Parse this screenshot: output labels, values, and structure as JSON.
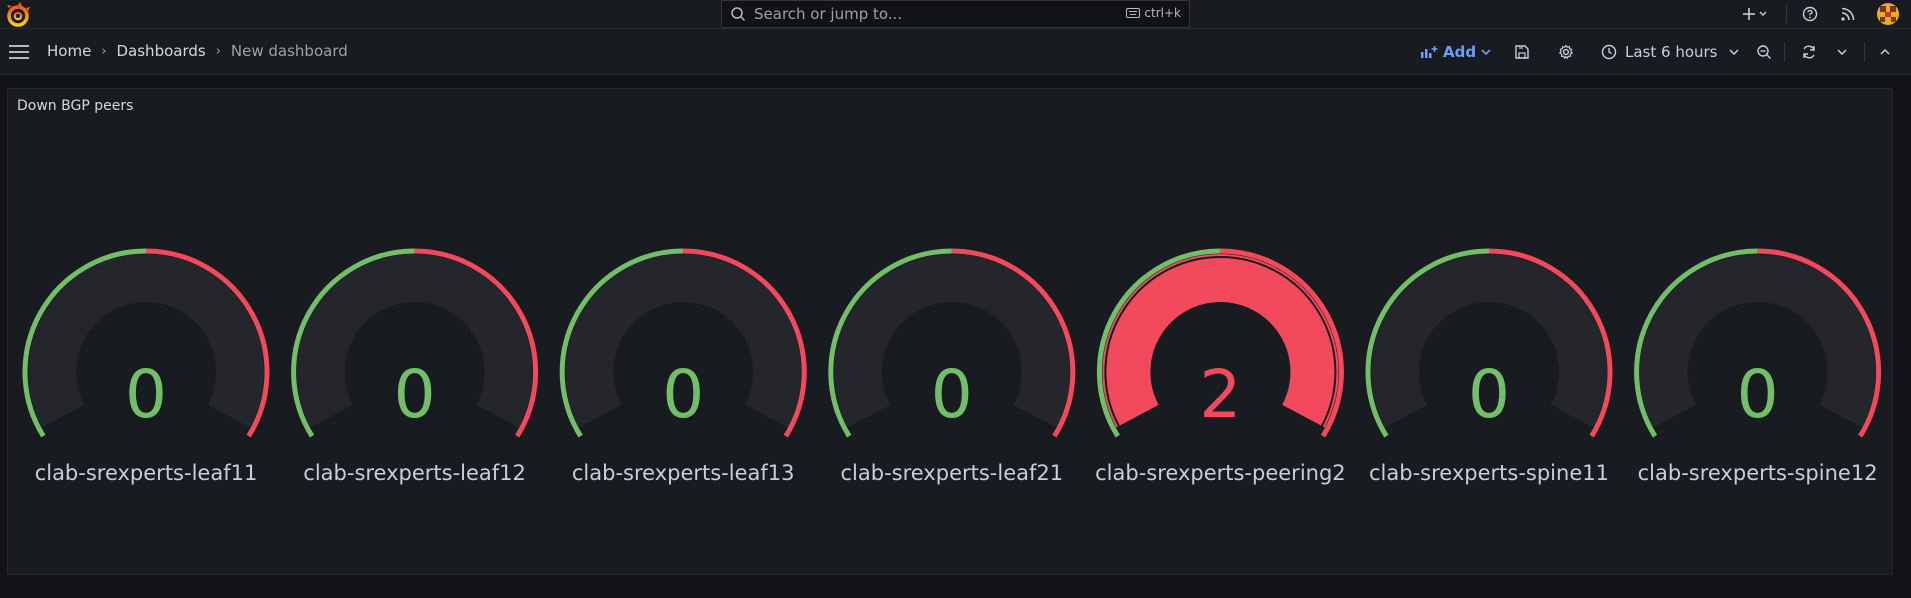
{
  "search": {
    "placeholder": "Search or jump to...",
    "shortcut": "ctrl+k"
  },
  "breadcrumb": {
    "home": "Home",
    "dashboards": "Dashboards",
    "current": "New dashboard"
  },
  "toolbar": {
    "add_label": "Add",
    "time_range": "Last 6 hours"
  },
  "panel": {
    "title": "Down BGP peers",
    "gauges": [
      {
        "label": "clab-srexperts-leaf11",
        "value": "0",
        "state": "ok"
      },
      {
        "label": "clab-srexperts-leaf12",
        "value": "0",
        "state": "ok"
      },
      {
        "label": "clab-srexperts-leaf13",
        "value": "0",
        "state": "ok"
      },
      {
        "label": "clab-srexperts-leaf21",
        "value": "0",
        "state": "ok"
      },
      {
        "label": "clab-srexperts-peering2",
        "value": "2",
        "state": "alert"
      },
      {
        "label": "clab-srexperts-spine11",
        "value": "0",
        "state": "ok"
      },
      {
        "label": "clab-srexperts-spine12",
        "value": "0",
        "state": "ok"
      }
    ]
  },
  "colors": {
    "ok": "#73bf69",
    "alert": "#f2495c",
    "track": "#24262c",
    "accent": "#6e9fff",
    "brand": "#f46800"
  },
  "icons": {
    "logo": "grafana-logo-icon",
    "search": "search-icon",
    "keyboard": "keyboard-icon",
    "plus": "plus-icon",
    "help": "help-icon",
    "news": "rss-icon",
    "avatar": "avatar-icon",
    "menu": "menu-icon",
    "save": "save-icon",
    "settings": "gear-icon",
    "clock": "clock-icon",
    "zoom_out": "zoom-out-icon",
    "refresh": "refresh-icon",
    "collapse": "chevron-up-icon"
  }
}
